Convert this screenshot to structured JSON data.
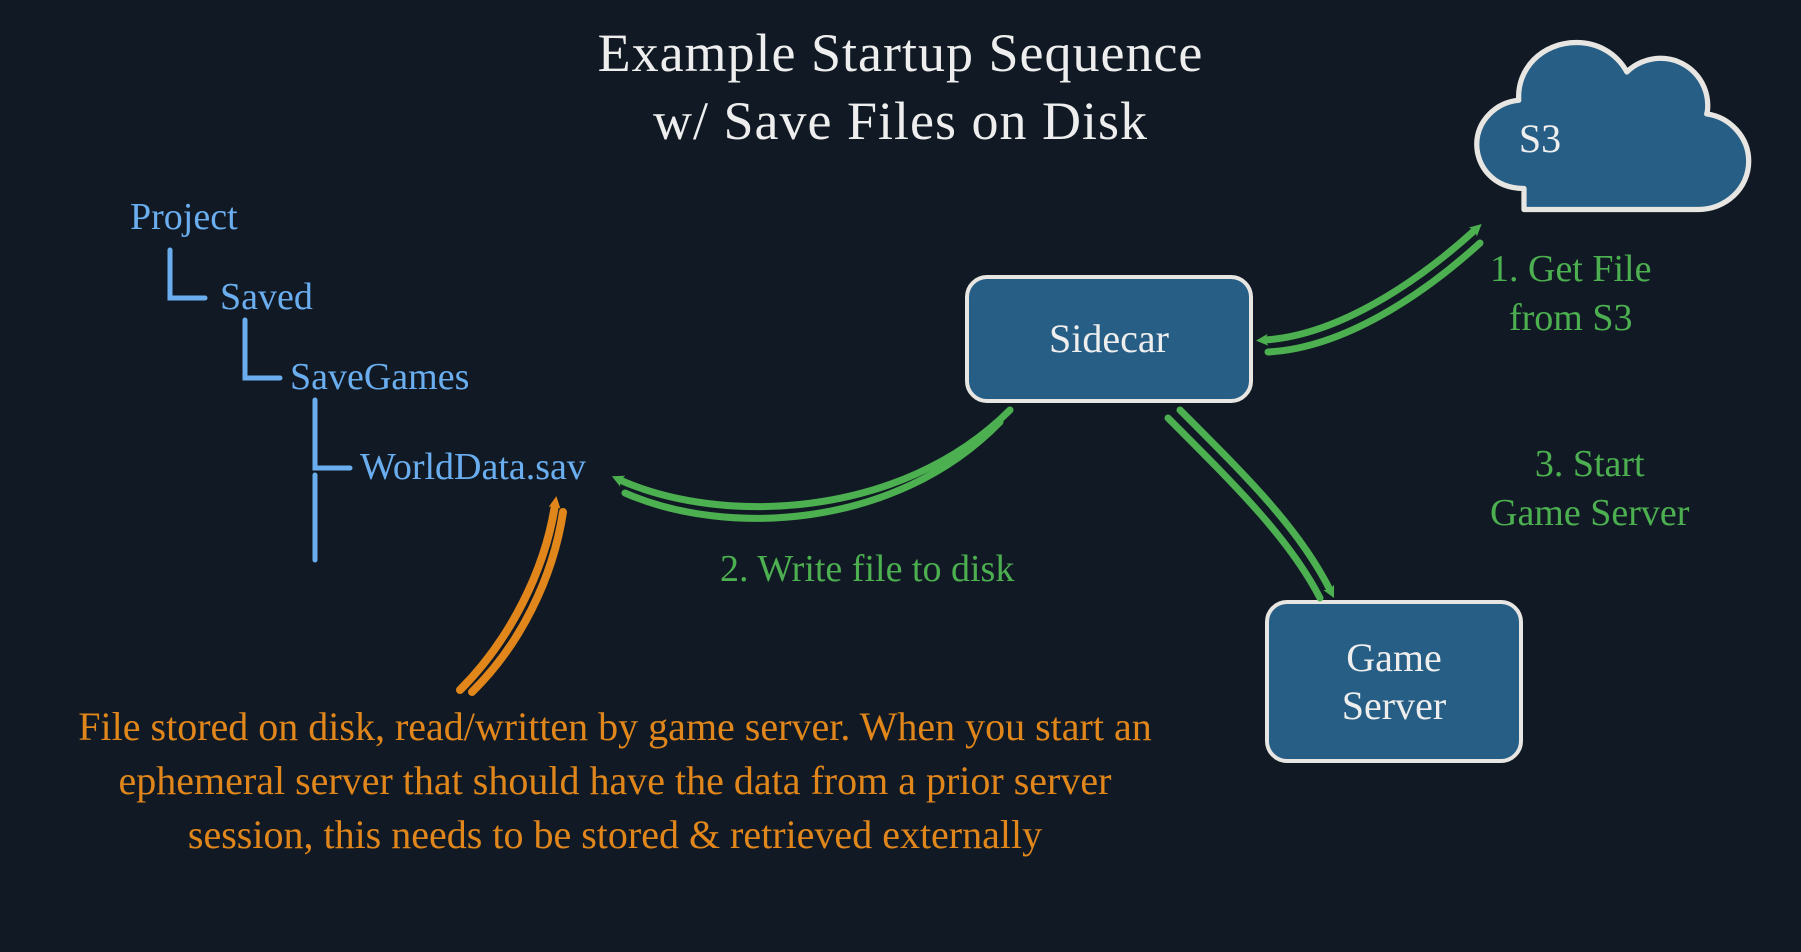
{
  "title": "Example Startup Sequence\nw/ Save Files on Disk",
  "tree": {
    "root": "Project",
    "l1": "Saved",
    "l2": "SaveGames",
    "l3": "WorldData.sav"
  },
  "nodes": {
    "s3": "S3",
    "sidecar": "Sidecar",
    "gameserver": "Game\nServer"
  },
  "steps": {
    "s1": "1. Get File\nfrom S3",
    "s2": "2. Write file to disk",
    "s3": "3. Start\nGame Server"
  },
  "annotation": "File stored on disk, read/written by game server.\nWhen you start an ephemeral server that should\nhave the data from a prior server session, this\nneeds to be stored & retrieved externally",
  "colors": {
    "bg": "#111a24",
    "title": "#eeeeee",
    "tree": "#6aaef0",
    "box_fill": "#275e85",
    "box_border": "#e8e6e2",
    "arrow_green": "#4caf50",
    "arrow_orange": "#e0861b"
  }
}
